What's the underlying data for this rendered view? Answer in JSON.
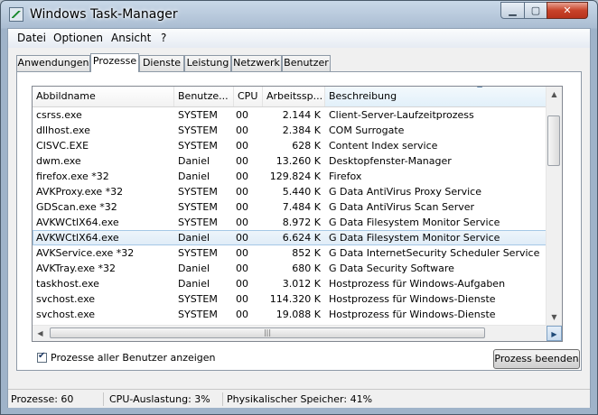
{
  "window": {
    "title": "Windows Task-Manager"
  },
  "menu": [
    "Datei",
    "Optionen",
    "Ansicht",
    "?"
  ],
  "tabs": [
    "Anwendungen",
    "Prozesse",
    "Dienste",
    "Leistung",
    "Netzwerk",
    "Benutzer"
  ],
  "active_tab": "Prozesse",
  "columns": [
    "Abbildname",
    "Benutze...",
    "CPU",
    "Arbeitssp...",
    "Beschreibung"
  ],
  "sorted_column": "Beschreibung",
  "processes": [
    [
      "csrss.exe",
      "SYSTEM",
      "00",
      "2.144 K",
      "Client-Server-Laufzeitprozess"
    ],
    [
      "dllhost.exe",
      "SYSTEM",
      "00",
      "2.384 K",
      "COM Surrogate"
    ],
    [
      "CISVC.EXE",
      "SYSTEM",
      "00",
      "628 K",
      "Content Index service"
    ],
    [
      "dwm.exe",
      "Daniel",
      "00",
      "13.260 K",
      "Desktopfenster-Manager"
    ],
    [
      "firefox.exe *32",
      "Daniel",
      "00",
      "129.824 K",
      "Firefox"
    ],
    [
      "AVKProxy.exe *32",
      "SYSTEM",
      "00",
      "5.440 K",
      "G Data AntiVirus Proxy Service"
    ],
    [
      "GDScan.exe *32",
      "SYSTEM",
      "00",
      "7.484 K",
      "G Data AntiVirus Scan Server"
    ],
    [
      "AVKWCtlX64.exe",
      "SYSTEM",
      "00",
      "8.972 K",
      "G Data Filesystem Monitor Service"
    ],
    [
      "AVKWCtlX64.exe",
      "Daniel",
      "00",
      "6.624 K",
      "G Data Filesystem Monitor Service"
    ],
    [
      "AVKService.exe *32",
      "SYSTEM",
      "00",
      "852 K",
      "G Data InternetSecurity Scheduler Service"
    ],
    [
      "AVKTray.exe *32",
      "Daniel",
      "00",
      "680 K",
      "G Data Security Software"
    ],
    [
      "taskhost.exe",
      "Daniel",
      "00",
      "3.012 K",
      "Hostprozess für Windows-Aufgaben"
    ],
    [
      "svchost.exe",
      "SYSTEM",
      "00",
      "114.320 K",
      "Hostprozess für Windows-Dienste"
    ],
    [
      "svchost.exe",
      "SYSTEM",
      "00",
      "19.088 K",
      "Hostprozess für Windows-Dienste"
    ]
  ],
  "selected_row": 8,
  "checkbox": {
    "label": "Prozesse aller Benutzer anzeigen",
    "checked": true
  },
  "end_process_label": "Prozess beenden",
  "status": {
    "processes": "Prozesse: 60",
    "cpu": "CPU-Auslastung: 3%",
    "memory": "Physikalischer Speicher: 41%"
  },
  "icons": [
    "task-manager-icon",
    "minimize-icon",
    "maximize-icon",
    "close-icon",
    "sort-up-icon",
    "scroll-up-icon",
    "scroll-down-icon",
    "scroll-right-icon",
    "grip-icon",
    "checkmark-icon"
  ]
}
